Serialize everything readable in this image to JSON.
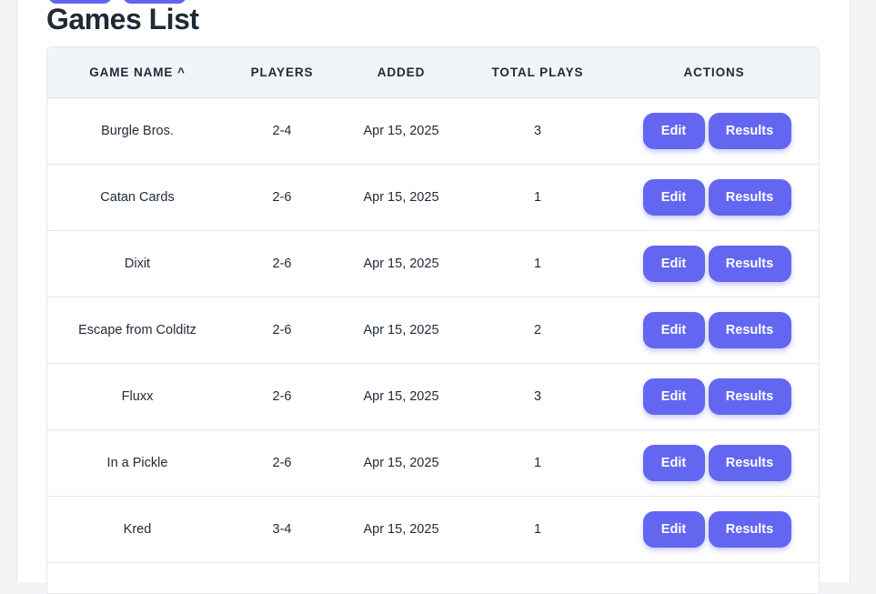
{
  "page": {
    "title": "Games List"
  },
  "table": {
    "columns": [
      "GAME NAME ^",
      "PLAYERS",
      "ADDED",
      "TOTAL PLAYS",
      "ACTIONS"
    ],
    "rows": [
      {
        "name": "Burgle Bros.",
        "players": "2-4",
        "added": "Apr 15, 2025",
        "total_plays": "3"
      },
      {
        "name": "Catan Cards",
        "players": "2-6",
        "added": "Apr 15, 2025",
        "total_plays": "1"
      },
      {
        "name": "Dixit",
        "players": "2-6",
        "added": "Apr 15, 2025",
        "total_plays": "1"
      },
      {
        "name": "Escape from Colditz",
        "players": "2-6",
        "added": "Apr 15, 2025",
        "total_plays": "2"
      },
      {
        "name": "Fluxx",
        "players": "2-6",
        "added": "Apr 15, 2025",
        "total_plays": "3"
      },
      {
        "name": "In a Pickle",
        "players": "2-6",
        "added": "Apr 15, 2025",
        "total_plays": "1"
      },
      {
        "name": "Kred",
        "players": "3-4",
        "added": "Apr 15, 2025",
        "total_plays": "1"
      }
    ],
    "edit_label": "Edit",
    "results_label": "Results"
  },
  "colors": {
    "accent": "#6366f1",
    "header_bg": "#f1f5f9",
    "text": "#1f2937"
  }
}
